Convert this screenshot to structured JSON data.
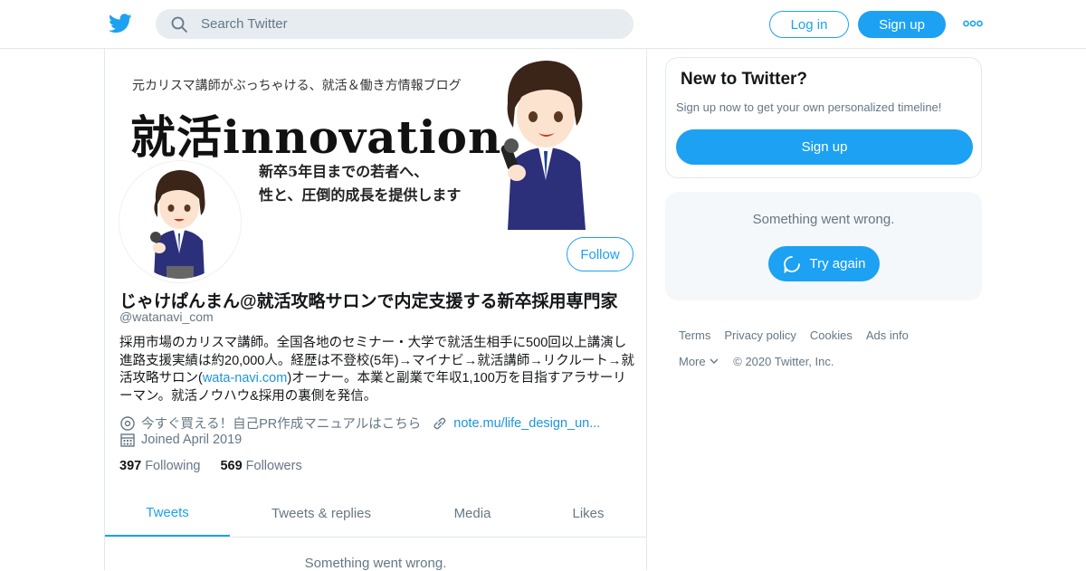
{
  "header": {
    "logo": "twitter-bird-icon",
    "search_placeholder": "Search Twitter",
    "login_label": "Log in",
    "signup_label": "Sign up"
  },
  "banner": {
    "subtitle": "元カリスマ講師がぶっちゃける、就活＆働き方情報ブログ",
    "title": "就活innovation",
    "line1": "新卒5年目までの若者へ、",
    "line2": "性と、圧倒的成長を提供します"
  },
  "profile": {
    "follow_label": "Follow",
    "name": "じゃけぱんまん@就活攻略サロンで内定支援する新卒採用専門家",
    "handle": "@watanavi_com",
    "bio_part1": "採用市場のカリスマ講師。全国各地のセミナー・大学で就活生相手に500回以上講演し進路支援実績は約20,000人。経歴は不登校(5年)→マイナビ→就活講師→リクルート→就活攻略サロン(",
    "bio_link": "wata-navi.com",
    "bio_part2": ")オーナー。本業と副業で年収1,100万を目指すアラサーリーマン。就活ノウハウ&採用の裏側を発信。",
    "location": "今すぐ買える！自己PR作成マニュアルはこちら",
    "url": "note.mu/life_design_un...",
    "joined": "Joined April 2019",
    "following_count": "397",
    "following_label": "Following",
    "followers_count": "569",
    "followers_label": "Followers"
  },
  "tabs": [
    {
      "label": "Tweets",
      "active": true
    },
    {
      "label": "Tweets & replies",
      "active": false
    },
    {
      "label": "Media",
      "active": false
    },
    {
      "label": "Likes",
      "active": false
    }
  ],
  "timeline_error": "Something went wrong.",
  "sidebar": {
    "new_title": "New to Twitter?",
    "new_text": "Sign up now to get your own personalized timeline!",
    "signup_label": "Sign up",
    "error_text": "Something went wrong.",
    "try_again_label": "Try again"
  },
  "footer": {
    "terms": "Terms",
    "privacy": "Privacy policy",
    "cookies": "Cookies",
    "ads": "Ads info",
    "more": "More",
    "copyright": "© 2020 Twitter, Inc."
  },
  "colors": {
    "accent": "#1da1f2",
    "muted": "#657786",
    "link": "#1b95e0"
  }
}
